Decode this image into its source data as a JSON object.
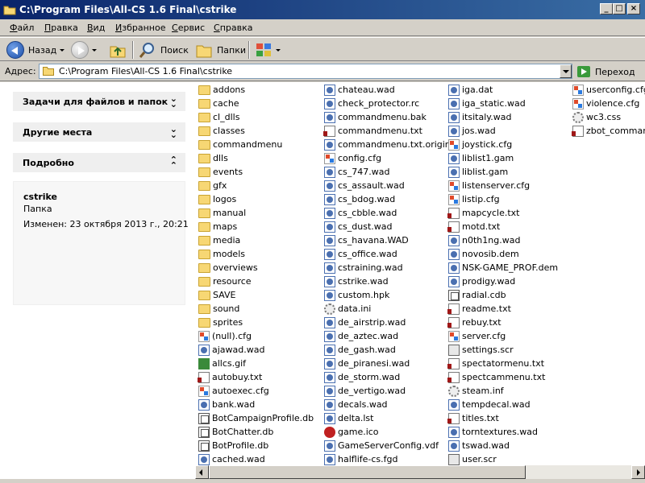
{
  "window": {
    "title": "C:\\Program Files\\All-CS 1.6 Final\\cstrike",
    "controls": {
      "minimize": "_",
      "maximize": "□",
      "close": "×"
    }
  },
  "menu": [
    "Файл",
    "Правка",
    "Вид",
    "Избранное",
    "Сервис",
    "Справка"
  ],
  "toolbar": {
    "back": "Назад",
    "search": "Поиск",
    "folders": "Папки"
  },
  "address": {
    "label": "Адрес:",
    "path": "C:\\Program Files\\All-CS 1.6 Final\\cstrike",
    "go": "Переход"
  },
  "taskpane": {
    "tasks_title": "Задачи для файлов и папок",
    "places_title": "Другие места",
    "details_title": "Подробно",
    "details": {
      "name": "cstrike",
      "kind": "Папка",
      "modified": "Изменен: 23 октября 2013 г., 20:21"
    }
  },
  "files": {
    "col1": [
      {
        "name": "addons",
        "icon": "folder"
      },
      {
        "name": "cache",
        "icon": "folder"
      },
      {
        "name": "cl_dlls",
        "icon": "folder"
      },
      {
        "name": "classes",
        "icon": "folder"
      },
      {
        "name": "commandmenu",
        "icon": "folder"
      },
      {
        "name": "dlls",
        "icon": "folder"
      },
      {
        "name": "events",
        "icon": "folder"
      },
      {
        "name": "gfx",
        "icon": "folder"
      },
      {
        "name": "logos",
        "icon": "folder"
      },
      {
        "name": "manual",
        "icon": "folder"
      },
      {
        "name": "maps",
        "icon": "folder"
      },
      {
        "name": "media",
        "icon": "folder"
      },
      {
        "name": "models",
        "icon": "folder"
      },
      {
        "name": "overviews",
        "icon": "folder"
      },
      {
        "name": "resource",
        "icon": "folder"
      },
      {
        "name": "SAVE",
        "icon": "folder"
      },
      {
        "name": "sound",
        "icon": "folder"
      },
      {
        "name": "sprites",
        "icon": "folder"
      },
      {
        "name": "(null).cfg",
        "icon": "cfg"
      },
      {
        "name": "ajawad.wad",
        "icon": "wad"
      },
      {
        "name": "allcs.gif",
        "icon": "gif"
      },
      {
        "name": "autobuy.txt",
        "icon": "txt"
      },
      {
        "name": "autoexec.cfg",
        "icon": "cfg"
      },
      {
        "name": "bank.wad",
        "icon": "wad"
      },
      {
        "name": "BotCampaignProfile.db",
        "icon": "mono"
      },
      {
        "name": "BotChatter.db",
        "icon": "mono"
      },
      {
        "name": "BotProfile.db",
        "icon": "mono"
      },
      {
        "name": "cached.wad",
        "icon": "wad"
      }
    ],
    "col2": [
      {
        "name": "chateau.wad",
        "icon": "wad"
      },
      {
        "name": "check_protector.rc",
        "icon": "wad"
      },
      {
        "name": "commandmenu.bak",
        "icon": "wad"
      },
      {
        "name": "commandmenu.txt",
        "icon": "txt"
      },
      {
        "name": "commandmenu.txt.original",
        "icon": "wad"
      },
      {
        "name": "config.cfg",
        "icon": "cfg"
      },
      {
        "name": "cs_747.wad",
        "icon": "wad"
      },
      {
        "name": "cs_assault.wad",
        "icon": "wad"
      },
      {
        "name": "cs_bdog.wad",
        "icon": "wad"
      },
      {
        "name": "cs_cbble.wad",
        "icon": "wad"
      },
      {
        "name": "cs_dust.wad",
        "icon": "wad"
      },
      {
        "name": "cs_havana.WAD",
        "icon": "wad"
      },
      {
        "name": "cs_office.wad",
        "icon": "wad"
      },
      {
        "name": "cstraining.wad",
        "icon": "wad"
      },
      {
        "name": "cstrike.wad",
        "icon": "wad"
      },
      {
        "name": "custom.hpk",
        "icon": "wad"
      },
      {
        "name": "data.ini",
        "icon": "gear"
      },
      {
        "name": "de_airstrip.wad",
        "icon": "wad"
      },
      {
        "name": "de_aztec.wad",
        "icon": "wad"
      },
      {
        "name": "de_gash.wad",
        "icon": "wad"
      },
      {
        "name": "de_piranesi.wad",
        "icon": "wad"
      },
      {
        "name": "de_storm.wad",
        "icon": "wad"
      },
      {
        "name": "de_vertigo.wad",
        "icon": "wad"
      },
      {
        "name": "decals.wad",
        "icon": "wad"
      },
      {
        "name": "delta.lst",
        "icon": "wad"
      },
      {
        "name": "game.ico",
        "icon": "ico"
      },
      {
        "name": "GameServerConfig.vdf",
        "icon": "wad"
      },
      {
        "name": "halflife-cs.fgd",
        "icon": "wad"
      }
    ],
    "col3": [
      {
        "name": "iga.dat",
        "icon": "wad"
      },
      {
        "name": "iga_static.wad",
        "icon": "wad"
      },
      {
        "name": "itsitaly.wad",
        "icon": "wad"
      },
      {
        "name": "jos.wad",
        "icon": "wad"
      },
      {
        "name": "joystick.cfg",
        "icon": "cfg"
      },
      {
        "name": "liblist1.gam",
        "icon": "wad"
      },
      {
        "name": "liblist.gam",
        "icon": "wad"
      },
      {
        "name": "listenserver.cfg",
        "icon": "cfg"
      },
      {
        "name": "listip.cfg",
        "icon": "cfg"
      },
      {
        "name": "mapcycle.txt",
        "icon": "txt"
      },
      {
        "name": "motd.txt",
        "icon": "txt"
      },
      {
        "name": "n0th1ng.wad",
        "icon": "wad"
      },
      {
        "name": "novosib.dem",
        "icon": "wad"
      },
      {
        "name": "NSK-GAME_PROF.dem",
        "icon": "wad"
      },
      {
        "name": "prodigy.wad",
        "icon": "wad"
      },
      {
        "name": "radial.cdb",
        "icon": "mono"
      },
      {
        "name": "readme.txt",
        "icon": "txt"
      },
      {
        "name": "rebuy.txt",
        "icon": "txt"
      },
      {
        "name": "server.cfg",
        "icon": "cfg"
      },
      {
        "name": "settings.scr",
        "icon": "setting"
      },
      {
        "name": "spectatormenu.txt",
        "icon": "txt"
      },
      {
        "name": "spectcammenu.txt",
        "icon": "txt"
      },
      {
        "name": "steam.inf",
        "icon": "gear"
      },
      {
        "name": "tempdecal.wad",
        "icon": "wad"
      },
      {
        "name": "titles.txt",
        "icon": "txt"
      },
      {
        "name": "torntextures.wad",
        "icon": "wad"
      },
      {
        "name": "tswad.wad",
        "icon": "wad"
      },
      {
        "name": "user.scr",
        "icon": "setting"
      }
    ],
    "col4": [
      {
        "name": "userconfig.cfg",
        "icon": "cfg"
      },
      {
        "name": "violence.cfg",
        "icon": "cfg"
      },
      {
        "name": "wc3.css",
        "icon": "gear"
      },
      {
        "name": "zbot_command",
        "icon": "txt"
      }
    ]
  }
}
